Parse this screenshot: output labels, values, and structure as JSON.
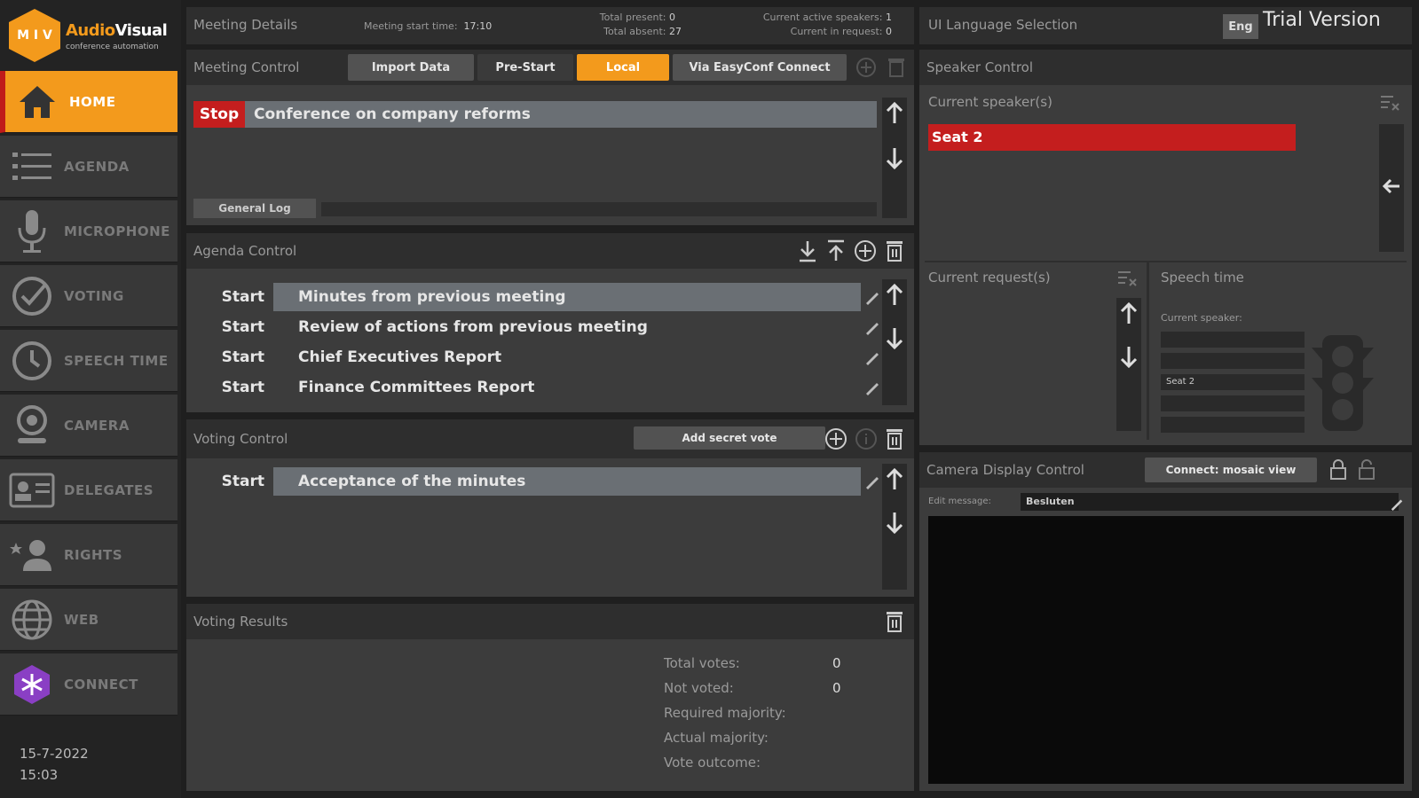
{
  "logo": {
    "hex_text": "M I V",
    "brand_a": "Audio",
    "brand_b": "Visual",
    "tagline": "conference automation"
  },
  "nav": [
    {
      "label": "HOME",
      "icon": "home-icon",
      "active": true
    },
    {
      "label": "AGENDA",
      "icon": "list-icon"
    },
    {
      "label": "MICROPHONE",
      "icon": "microphone-icon"
    },
    {
      "label": "VOTING",
      "icon": "check-circle-icon"
    },
    {
      "label": "SPEECH TIME",
      "icon": "clock-icon"
    },
    {
      "label": "CAMERA",
      "icon": "camera-icon"
    },
    {
      "label": "DELEGATES",
      "icon": "id-card-icon"
    },
    {
      "label": "RIGHTS",
      "icon": "user-star-icon"
    },
    {
      "label": "WEB",
      "icon": "globe-icon"
    },
    {
      "label": "CONNECT",
      "icon": "connect-logo-icon"
    }
  ],
  "date": "15-7-2022",
  "time": "15:03",
  "meeting_details": {
    "title": "Meeting Details",
    "start_label": "Meeting start time:",
    "start_value": "17:10",
    "present_label": "Total present:",
    "present_value": "0",
    "absent_label": "Total absent:",
    "absent_value": "27",
    "active_label": "Current active speakers:",
    "active_value": "1",
    "request_label": "Current in request:",
    "request_value": "0"
  },
  "language": {
    "title": "UI Language Selection",
    "value": "Eng",
    "trial": "Trial Version"
  },
  "meeting_control": {
    "title": "Meeting Control",
    "buttons": [
      "Import Data",
      "Pre-Start",
      "Local",
      "Via EasyConf Connect"
    ],
    "stop_label": "Stop",
    "meeting_name": "Conference on company reforms",
    "log_label": "General Log"
  },
  "agenda": {
    "title": "Agenda Control",
    "items": [
      {
        "action": "Start",
        "text": "Minutes from previous meeting"
      },
      {
        "action": "Start",
        "text": "Review of actions from previous meeting"
      },
      {
        "action": "Start",
        "text": "Chief Executives Report"
      },
      {
        "action": "Start",
        "text": "Finance Committees Report"
      }
    ]
  },
  "voting": {
    "title": "Voting Control",
    "add_secret": "Add secret vote",
    "items": [
      {
        "action": "Start",
        "text": "Acceptance of the minutes"
      }
    ]
  },
  "results": {
    "title": "Voting Results",
    "labels": [
      "Total votes:",
      "Not voted:",
      "Required majority:",
      "Actual majority:",
      "Vote outcome:"
    ],
    "values": [
      "0",
      "0",
      "",
      "",
      ""
    ]
  },
  "speaker": {
    "title": "Speaker Control",
    "current_label": "Current speaker(s)",
    "current_speaker": "Seat 2",
    "requests_label": "Current request(s)",
    "speech_time_label": "Speech time",
    "current_speaker_small": "Current speaker:",
    "time_rows": [
      "",
      "",
      "Seat 2",
      "",
      ""
    ]
  },
  "camera": {
    "title": "Camera Display Control",
    "mosaic_button": "Connect: mosaic view",
    "edit_label": "Edit message:",
    "edit_value": "Besluten"
  },
  "colors": {
    "accent": "#f39a1c",
    "stop": "#c41e1e",
    "panel": "#3c3c3c",
    "header": "#2e2e2e"
  }
}
